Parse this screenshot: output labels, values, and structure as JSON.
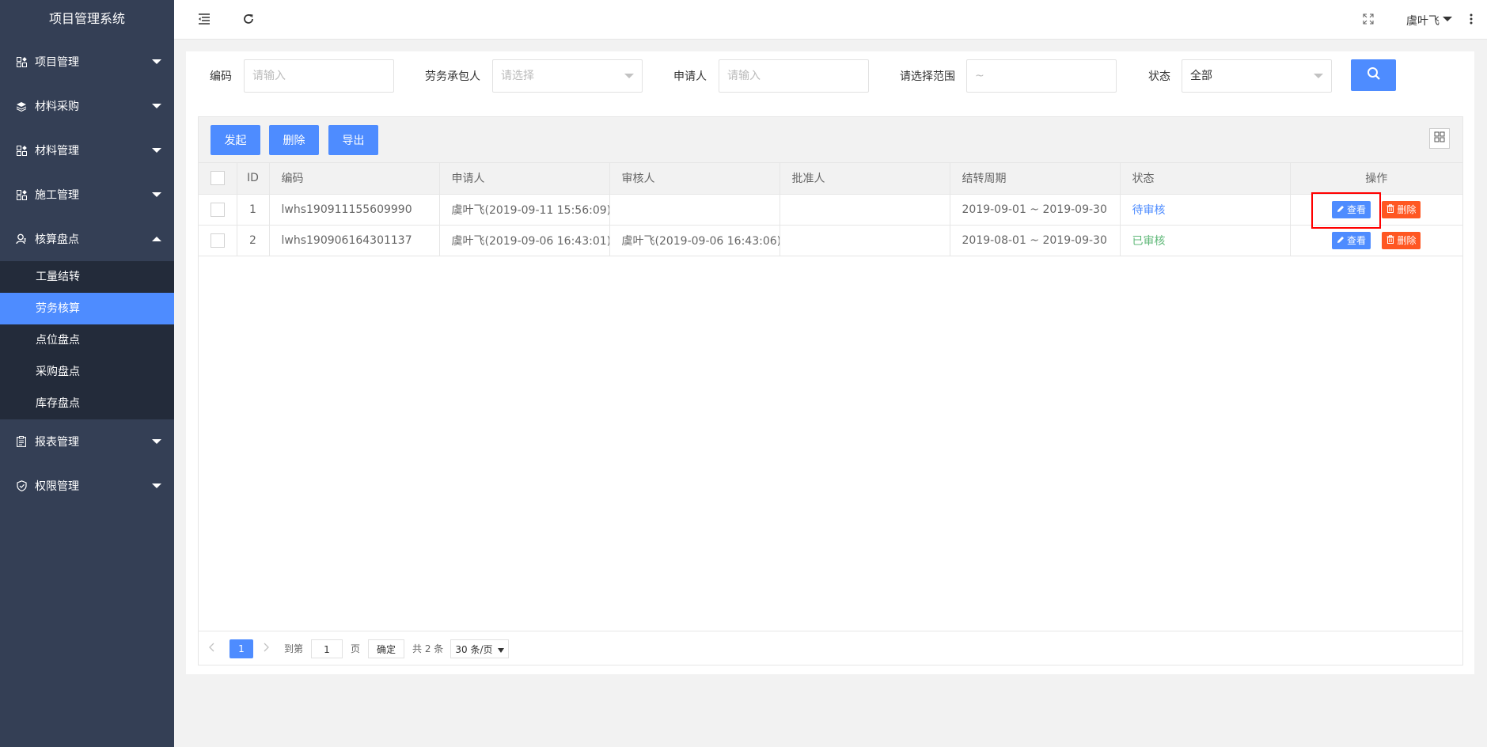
{
  "sidebar": {
    "title": "项目管理系统",
    "items": [
      {
        "label": "项目管理",
        "icon": "module-icon"
      },
      {
        "label": "材料采购",
        "icon": "layers-icon"
      },
      {
        "label": "材料管理",
        "icon": "module-icon"
      },
      {
        "label": "施工管理",
        "icon": "module-icon"
      },
      {
        "label": "核算盘点",
        "icon": "user-icon",
        "expanded": true
      },
      {
        "label": "报表管理",
        "icon": "report-icon"
      },
      {
        "label": "权限管理",
        "icon": "shield-icon"
      }
    ],
    "subitems": [
      {
        "label": "工量结转"
      },
      {
        "label": "劳务核算",
        "active": true
      },
      {
        "label": "点位盘点"
      },
      {
        "label": "采购盘点"
      },
      {
        "label": "库存盘点"
      }
    ]
  },
  "header": {
    "user": "虞叶飞"
  },
  "filters": {
    "code_label": "编码",
    "code_placeholder": "请输入",
    "contractor_label": "劳务承包人",
    "contractor_placeholder": "请选择",
    "applicant_label": "申请人",
    "applicant_placeholder": "请输入",
    "range_label": "请选择范围",
    "range_placeholder": "~",
    "status_label": "状态",
    "status_value": "全部"
  },
  "toolbar": {
    "start_label": "发起",
    "delete_label": "删除",
    "export_label": "导出"
  },
  "table": {
    "headers": {
      "id": "ID",
      "code": "编码",
      "applicant": "申请人",
      "reviewer": "审核人",
      "approver": "批准人",
      "period": "结转周期",
      "status": "状态",
      "ops": "操作"
    },
    "rows": [
      {
        "id": "1",
        "code": "lwhs190911155609990",
        "applicant": "虞叶飞(2019-09-11 15:56:09)",
        "reviewer": "",
        "approver": "",
        "period": "2019-09-01 ~ 2019-09-30",
        "status": "待审核"
      },
      {
        "id": "2",
        "code": "lwhs190906164301137",
        "applicant": "虞叶飞(2019-09-06 16:43:01)",
        "reviewer": "虞叶飞(2019-09-06 16:43:06)",
        "approver": "",
        "period": "2019-08-01 ~ 2019-09-30",
        "status": "已审核"
      }
    ],
    "view_label": "查看",
    "del_label": "删除"
  },
  "pager": {
    "current": "1",
    "goto_label": "到第",
    "goto_value": "1",
    "page_unit": "页",
    "confirm_label": "确定",
    "total": "共 2 条",
    "page_size": "30 条/页"
  },
  "colors": {
    "primary": "#4e8cff",
    "danger": "#ff5722",
    "success": "#5fb878",
    "sidebar": "#343f55"
  }
}
